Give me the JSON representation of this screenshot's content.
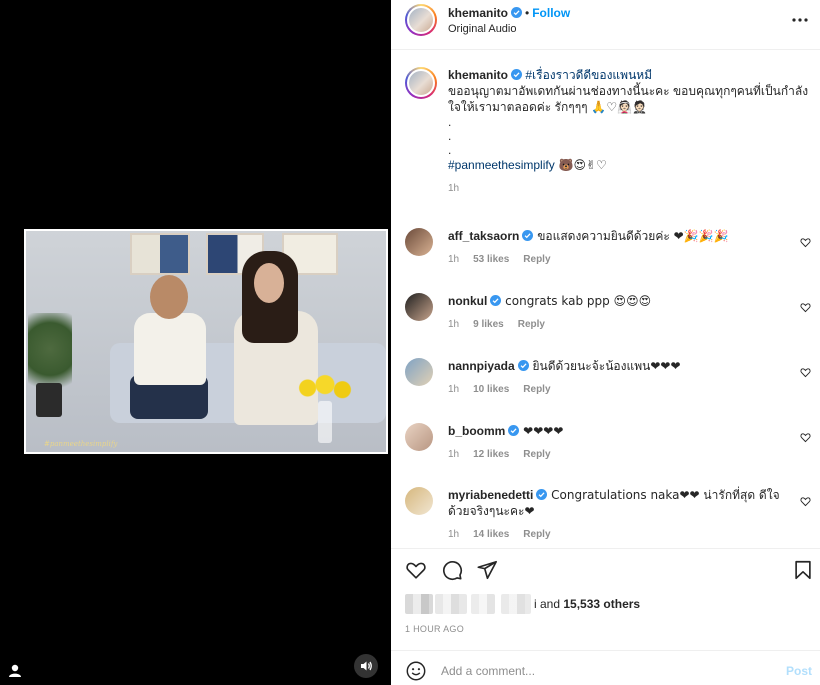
{
  "post": {
    "username": "khemanito",
    "follow_label": "Follow",
    "dot": "•",
    "audio": "Original Audio",
    "more_label": "•••"
  },
  "caption": {
    "username": "khemanito",
    "hashtag1": "#เรื่องราวดีดีของแพนหมี",
    "text": "ขออนุญาตมาอัพเดทกันผ่านช่องทางนี้นะคะ ขอบคุณทุกๆคนที่เป็นกำลังใจให้เรามาตลอดค่ะ รักๆๆๆ",
    "emoji": " 🙏♡👰🏻🤵🏻",
    "dots": [
      ".",
      ".",
      "."
    ],
    "hashtag2": "#panmeethesimplify",
    "emoji2": " 🐻😍✌♡",
    "time": "1h"
  },
  "comments": [
    {
      "username": "aff_taksaorn",
      "verified": true,
      "text": " ขอแสดงความยินดีด้วยค่ะ ❤🎉🎉🎉",
      "time": "1h",
      "likes": "53 likes",
      "reply": "Reply"
    },
    {
      "username": "nonkul",
      "verified": true,
      "text": " congrats kab ppp 😍😍😍",
      "time": "1h",
      "likes": "9 likes",
      "reply": "Reply"
    },
    {
      "username": "nannpiyada",
      "verified": true,
      "text": " ยินดีด้วยนะจ้ะน้องแพน❤❤❤",
      "time": "1h",
      "likes": "10 likes",
      "reply": "Reply"
    },
    {
      "username": "b_boomm",
      "verified": true,
      "text": " ❤❤❤❤",
      "time": "1h",
      "likes": "12 likes",
      "reply": "Reply"
    },
    {
      "username": "myriabenedetti",
      "verified": true,
      "text": " Congratulations naka❤❤ น่ารักที่สุด ดีใจด้วยจริงๆนะคะ❤",
      "time": "1h",
      "likes": "14 likes",
      "reply": "Reply"
    }
  ],
  "likes": {
    "suffix": "i and",
    "count": "15,533 others"
  },
  "time_ago": "1 HOUR AGO",
  "add_comment": {
    "placeholder": "Add a comment...",
    "post_label": "Post"
  },
  "video": {
    "watermark": "#panmeethesimplify"
  },
  "colors": {
    "accent": "#0095f6",
    "verified": "#3897f0",
    "heart": "#ed4956",
    "muted": "#8e8e8e",
    "post_disabled": "#b2dffc"
  }
}
